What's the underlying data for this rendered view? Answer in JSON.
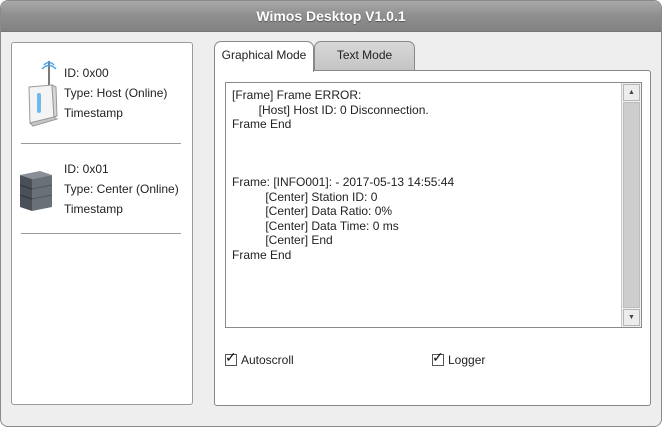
{
  "window": {
    "title": "Wimos Desktop V1.0.1"
  },
  "devices": [
    {
      "id": "ID: 0x00",
      "type": "Type: Host (Online)",
      "timestamp": "Timestamp",
      "icon": "router-icon"
    },
    {
      "id": "ID: 0x01",
      "type": "Type: Center (Online)",
      "timestamp": "Timestamp",
      "icon": "server-icon"
    }
  ],
  "tabs": [
    {
      "label": "Graphical Mode",
      "active": true
    },
    {
      "label": "Text Mode",
      "active": false
    }
  ],
  "log": {
    "lines": [
      "[Frame] Frame ERROR:",
      "        [Host] Host ID: 0 Disconnection.",
      "Frame End",
      "",
      "",
      "",
      "Frame: [INFO001]: - 2017-05-13 14:55:44",
      "          [Center] Station ID: 0",
      "          [Center] Data Ratio: 0%",
      "          [Center] Data Time: 0 ms",
      "          [Center] End",
      "Frame End"
    ]
  },
  "options": {
    "autoscroll": {
      "label": "Autoscroll",
      "checked": true
    },
    "logger": {
      "label": "Logger",
      "checked": true
    }
  },
  "colors": {
    "titlebar": "#8e8e8e",
    "background": "#eeeeee",
    "panel": "#ffffff",
    "border": "#888888"
  }
}
